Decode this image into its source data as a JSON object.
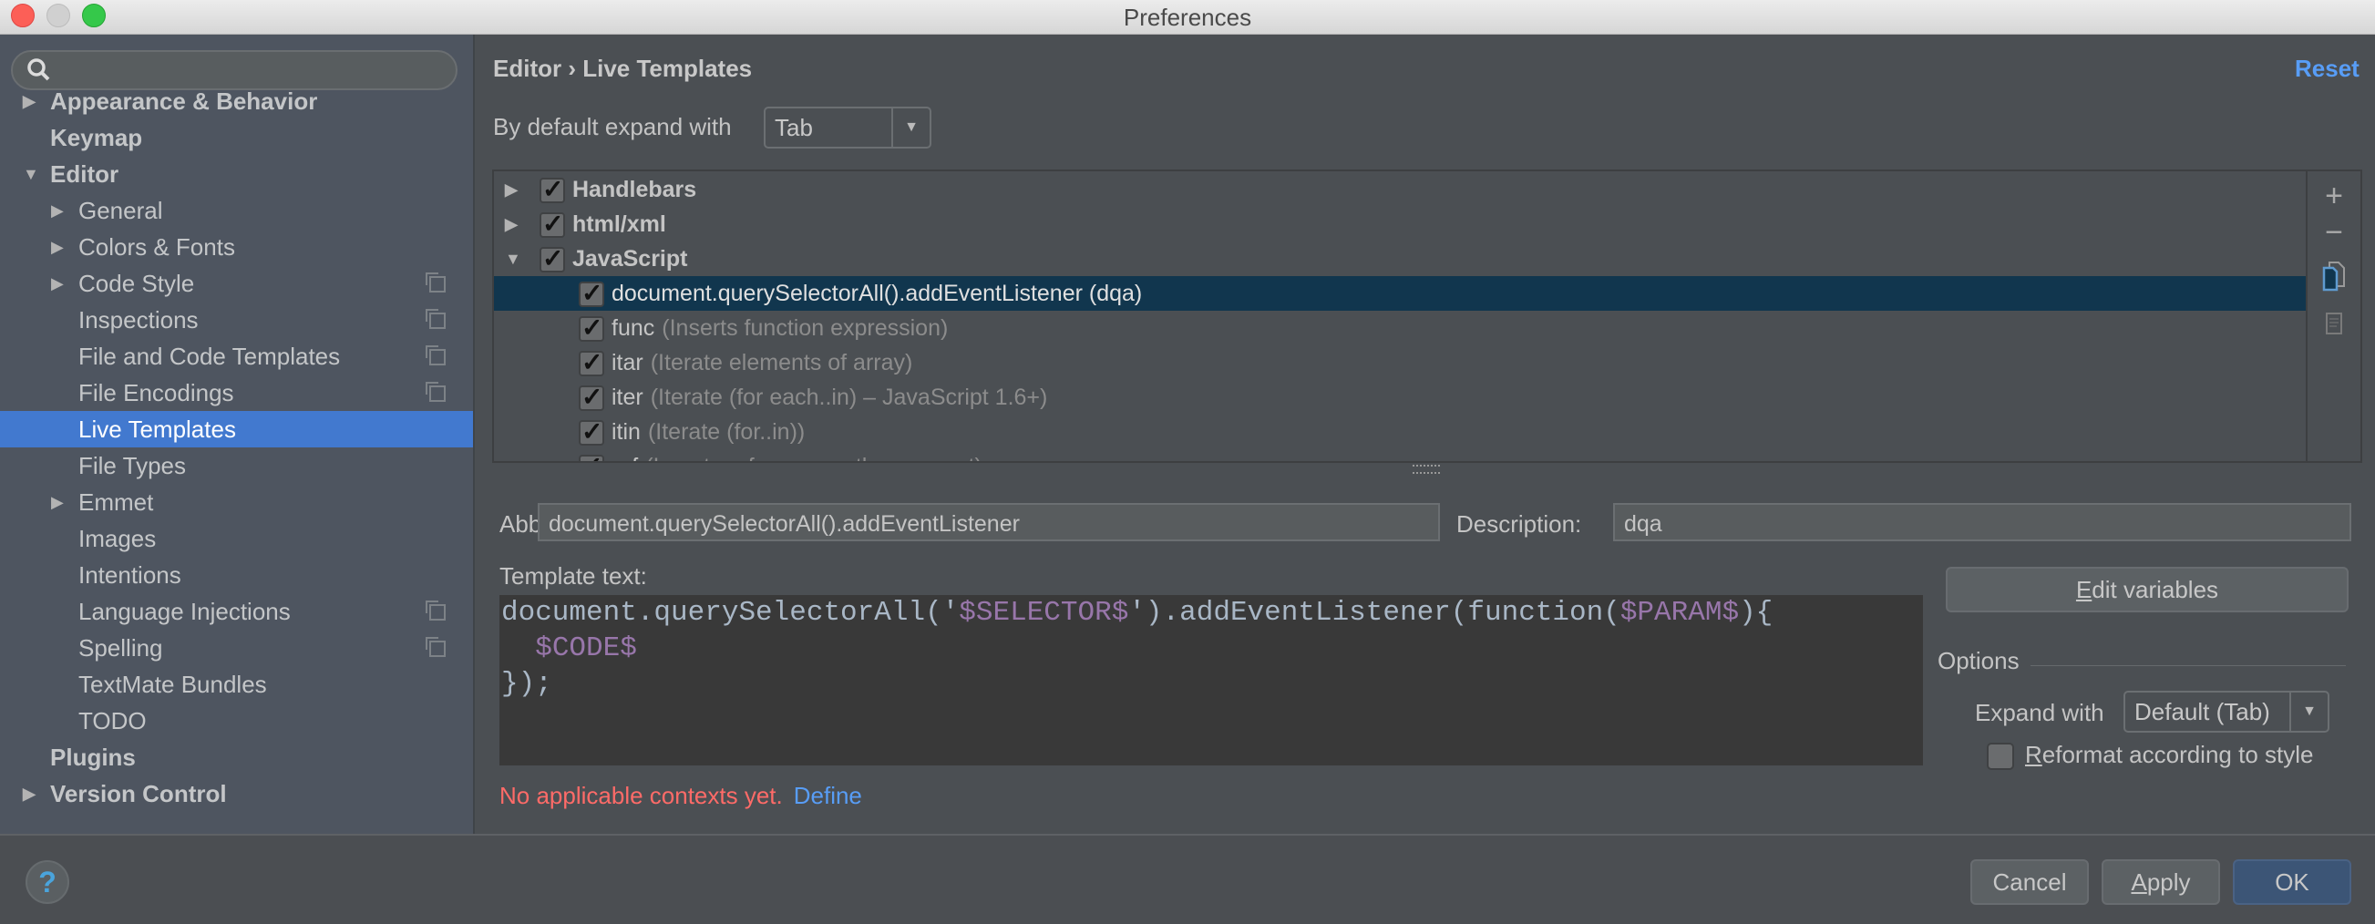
{
  "window": {
    "title": "Preferences"
  },
  "sidebar": {
    "search_placeholder": "",
    "items": [
      {
        "label": "Appearance & Behavior",
        "level": 0,
        "bold": true,
        "expandable": true,
        "expanded": false
      },
      {
        "label": "Keymap",
        "level": 0,
        "bold": true
      },
      {
        "label": "Editor",
        "level": 0,
        "bold": true,
        "expandable": true,
        "expanded": true
      },
      {
        "label": "General",
        "level": 1,
        "expandable": true,
        "expanded": false
      },
      {
        "label": "Colors & Fonts",
        "level": 1,
        "expandable": true,
        "expanded": false
      },
      {
        "label": "Code Style",
        "level": 1,
        "expandable": true,
        "expanded": false,
        "project_icon": true
      },
      {
        "label": "Inspections",
        "level": 1,
        "project_icon": true
      },
      {
        "label": "File and Code Templates",
        "level": 1,
        "project_icon": true
      },
      {
        "label": "File Encodings",
        "level": 1,
        "project_icon": true
      },
      {
        "label": "Live Templates",
        "level": 1,
        "selected": true
      },
      {
        "label": "File Types",
        "level": 1
      },
      {
        "label": "Emmet",
        "level": 1,
        "expandable": true,
        "expanded": false
      },
      {
        "label": "Images",
        "level": 1
      },
      {
        "label": "Intentions",
        "level": 1
      },
      {
        "label": "Language Injections",
        "level": 1,
        "project_icon": true
      },
      {
        "label": "Spelling",
        "level": 1,
        "project_icon": true
      },
      {
        "label": "TextMate Bundles",
        "level": 1
      },
      {
        "label": "TODO",
        "level": 1
      },
      {
        "label": "Plugins",
        "level": 0,
        "bold": true
      },
      {
        "label": "Version Control",
        "level": 0,
        "bold": true,
        "expandable": true,
        "expanded": false
      }
    ]
  },
  "header": {
    "breadcrumb": "Editor › Live Templates",
    "reset_label": "Reset"
  },
  "default_expand": {
    "label": "By default expand with",
    "value": "Tab"
  },
  "tree": {
    "rows": [
      {
        "name": "Handlebars",
        "type": "group",
        "expanded": false,
        "checked": true
      },
      {
        "name": "html/xml",
        "type": "group",
        "expanded": false,
        "checked": true
      },
      {
        "name": "JavaScript",
        "type": "group",
        "expanded": true,
        "checked": true
      },
      {
        "name": "document.querySelectorAll().addEventListener (dqa)",
        "desc": "",
        "type": "item",
        "checked": true,
        "selected": true
      },
      {
        "name": "func",
        "desc": "(Inserts function expression)",
        "type": "item",
        "checked": true
      },
      {
        "name": "itar",
        "desc": "(Iterate elements of array)",
        "type": "item",
        "checked": true
      },
      {
        "name": "iter",
        "desc": "(Iterate (for each..in) – JavaScript 1.6+)",
        "type": "item",
        "checked": true
      },
      {
        "name": "itin",
        "desc": "(Iterate (for..in))",
        "type": "item",
        "checked": true
      },
      {
        "name": "ref",
        "desc": "(Inserts reference path comment)",
        "type": "item",
        "checked": true
      }
    ],
    "tools": {
      "add": "+",
      "remove": "−"
    }
  },
  "abbreviation": {
    "label": "Abbreviation:",
    "value": "document.querySelectorAll().addEventListener"
  },
  "description": {
    "label": "Description:",
    "value": "dqa"
  },
  "template_text": {
    "label": "Template text:",
    "lines": [
      [
        {
          "t": "document.querySelectorAll('"
        },
        {
          "t": "$SELECTOR$",
          "v": true
        },
        {
          "t": "').addEventListener(function("
        },
        {
          "t": "$PARAM$",
          "v": true
        },
        {
          "t": "){"
        }
      ],
      [
        {
          "t": "  "
        },
        {
          "t": "$CODE$",
          "v": true
        }
      ],
      [
        {
          "t": "});"
        }
      ]
    ]
  },
  "context": {
    "message": "No applicable contexts yet.",
    "define_label": "Define"
  },
  "edit_variables": {
    "label_u": "E",
    "label_rest": "dit variables"
  },
  "options": {
    "title": "Options",
    "expand_label": "Expand with",
    "expand_value": "Default (Tab)",
    "reformat_u": "R",
    "reformat_rest": "eformat according to style",
    "reformat_checked": false
  },
  "footer": {
    "cancel": "Cancel",
    "apply_u": "A",
    "apply_rest": "pply",
    "ok": "OK",
    "help": "?"
  },
  "colors": {
    "accent": "#4279cf",
    "link": "#589df6",
    "error": "#ff6b68",
    "template_var": "#9876aa",
    "selection": "#11364e"
  }
}
